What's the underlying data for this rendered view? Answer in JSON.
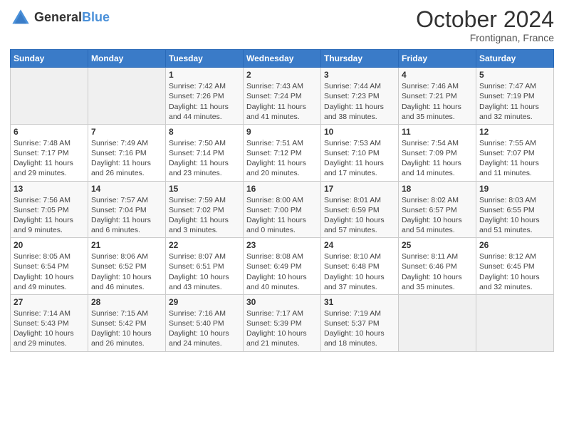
{
  "header": {
    "logo_line1": "General",
    "logo_line2": "Blue",
    "month": "October 2024",
    "location": "Frontignan, France"
  },
  "days_of_week": [
    "Sunday",
    "Monday",
    "Tuesday",
    "Wednesday",
    "Thursday",
    "Friday",
    "Saturday"
  ],
  "weeks": [
    [
      {
        "day": "",
        "info": ""
      },
      {
        "day": "",
        "info": ""
      },
      {
        "day": "1",
        "info": "Sunrise: 7:42 AM\nSunset: 7:26 PM\nDaylight: 11 hours and 44 minutes."
      },
      {
        "day": "2",
        "info": "Sunrise: 7:43 AM\nSunset: 7:24 PM\nDaylight: 11 hours and 41 minutes."
      },
      {
        "day": "3",
        "info": "Sunrise: 7:44 AM\nSunset: 7:23 PM\nDaylight: 11 hours and 38 minutes."
      },
      {
        "day": "4",
        "info": "Sunrise: 7:46 AM\nSunset: 7:21 PM\nDaylight: 11 hours and 35 minutes."
      },
      {
        "day": "5",
        "info": "Sunrise: 7:47 AM\nSunset: 7:19 PM\nDaylight: 11 hours and 32 minutes."
      }
    ],
    [
      {
        "day": "6",
        "info": "Sunrise: 7:48 AM\nSunset: 7:17 PM\nDaylight: 11 hours and 29 minutes."
      },
      {
        "day": "7",
        "info": "Sunrise: 7:49 AM\nSunset: 7:16 PM\nDaylight: 11 hours and 26 minutes."
      },
      {
        "day": "8",
        "info": "Sunrise: 7:50 AM\nSunset: 7:14 PM\nDaylight: 11 hours and 23 minutes."
      },
      {
        "day": "9",
        "info": "Sunrise: 7:51 AM\nSunset: 7:12 PM\nDaylight: 11 hours and 20 minutes."
      },
      {
        "day": "10",
        "info": "Sunrise: 7:53 AM\nSunset: 7:10 PM\nDaylight: 11 hours and 17 minutes."
      },
      {
        "day": "11",
        "info": "Sunrise: 7:54 AM\nSunset: 7:09 PM\nDaylight: 11 hours and 14 minutes."
      },
      {
        "day": "12",
        "info": "Sunrise: 7:55 AM\nSunset: 7:07 PM\nDaylight: 11 hours and 11 minutes."
      }
    ],
    [
      {
        "day": "13",
        "info": "Sunrise: 7:56 AM\nSunset: 7:05 PM\nDaylight: 11 hours and 9 minutes."
      },
      {
        "day": "14",
        "info": "Sunrise: 7:57 AM\nSunset: 7:04 PM\nDaylight: 11 hours and 6 minutes."
      },
      {
        "day": "15",
        "info": "Sunrise: 7:59 AM\nSunset: 7:02 PM\nDaylight: 11 hours and 3 minutes."
      },
      {
        "day": "16",
        "info": "Sunrise: 8:00 AM\nSunset: 7:00 PM\nDaylight: 11 hours and 0 minutes."
      },
      {
        "day": "17",
        "info": "Sunrise: 8:01 AM\nSunset: 6:59 PM\nDaylight: 10 hours and 57 minutes."
      },
      {
        "day": "18",
        "info": "Sunrise: 8:02 AM\nSunset: 6:57 PM\nDaylight: 10 hours and 54 minutes."
      },
      {
        "day": "19",
        "info": "Sunrise: 8:03 AM\nSunset: 6:55 PM\nDaylight: 10 hours and 51 minutes."
      }
    ],
    [
      {
        "day": "20",
        "info": "Sunrise: 8:05 AM\nSunset: 6:54 PM\nDaylight: 10 hours and 49 minutes."
      },
      {
        "day": "21",
        "info": "Sunrise: 8:06 AM\nSunset: 6:52 PM\nDaylight: 10 hours and 46 minutes."
      },
      {
        "day": "22",
        "info": "Sunrise: 8:07 AM\nSunset: 6:51 PM\nDaylight: 10 hours and 43 minutes."
      },
      {
        "day": "23",
        "info": "Sunrise: 8:08 AM\nSunset: 6:49 PM\nDaylight: 10 hours and 40 minutes."
      },
      {
        "day": "24",
        "info": "Sunrise: 8:10 AM\nSunset: 6:48 PM\nDaylight: 10 hours and 37 minutes."
      },
      {
        "day": "25",
        "info": "Sunrise: 8:11 AM\nSunset: 6:46 PM\nDaylight: 10 hours and 35 minutes."
      },
      {
        "day": "26",
        "info": "Sunrise: 8:12 AM\nSunset: 6:45 PM\nDaylight: 10 hours and 32 minutes."
      }
    ],
    [
      {
        "day": "27",
        "info": "Sunrise: 7:14 AM\nSunset: 5:43 PM\nDaylight: 10 hours and 29 minutes."
      },
      {
        "day": "28",
        "info": "Sunrise: 7:15 AM\nSunset: 5:42 PM\nDaylight: 10 hours and 26 minutes."
      },
      {
        "day": "29",
        "info": "Sunrise: 7:16 AM\nSunset: 5:40 PM\nDaylight: 10 hours and 24 minutes."
      },
      {
        "day": "30",
        "info": "Sunrise: 7:17 AM\nSunset: 5:39 PM\nDaylight: 10 hours and 21 minutes."
      },
      {
        "day": "31",
        "info": "Sunrise: 7:19 AM\nSunset: 5:37 PM\nDaylight: 10 hours and 18 minutes."
      },
      {
        "day": "",
        "info": ""
      },
      {
        "day": "",
        "info": ""
      }
    ]
  ]
}
